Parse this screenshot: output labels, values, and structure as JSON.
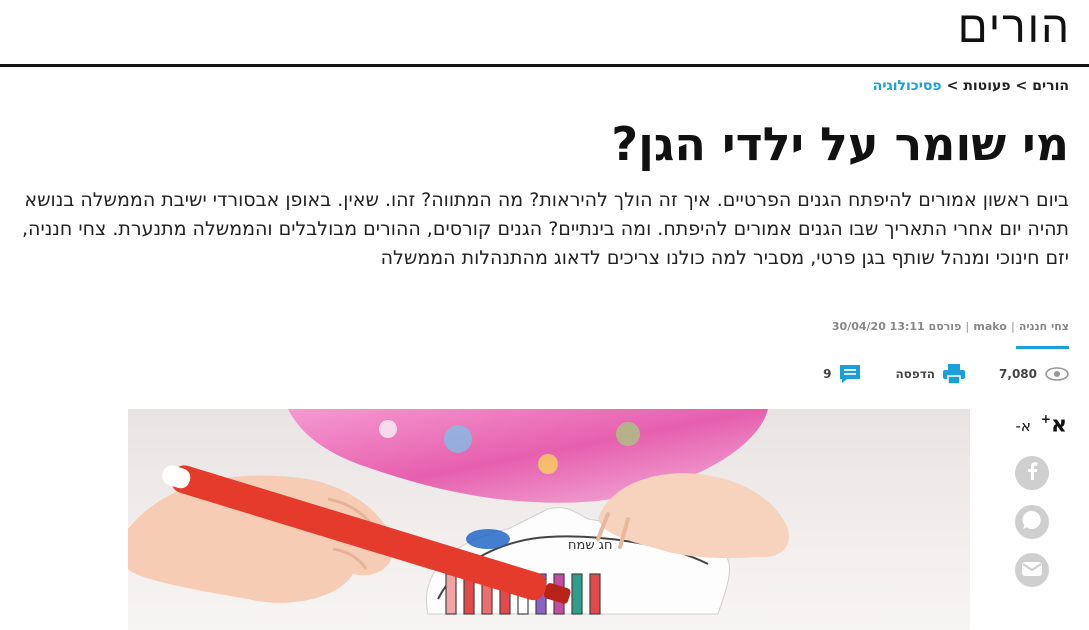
{
  "section": {
    "title": "הורים"
  },
  "breadcrumb": {
    "items": [
      "הורים",
      "פעוטות",
      "פסיכולוגיה"
    ],
    "separator": ">"
  },
  "article": {
    "headline": "מי שומר על ילדי הגן?",
    "subtitle": "ביום ראשון אמורים להיפתח הגנים הפרטיים. איך זה הולך להיראות? מה המתווה? זהו. שאין. באופן אבסורדי ישיבת הממשלה בנושא תהיה יום אחרי התאריך שבו הגנים אמורים להיפתח. ומה בינתיים? הגנים קורסים, ההורים מבולבלים והממשלה מתנערת. צחי חנניה, יזם חינוכי ומנהל שותף בגן פרטי, מסביר למה כולנו צריכים לדאוג מהתנהלות הממשלה",
    "author": "צחי חנניה",
    "source": "mako",
    "published_label": "פורסם",
    "published": "30/04/20 13:11"
  },
  "stats": {
    "views": "7,080",
    "print_label": "הדפסה",
    "comments": "9"
  },
  "font_controls": {
    "increase": "א",
    "increase_sign": "+",
    "decrease": "א",
    "decrease_sign": "-"
  },
  "share": {
    "icons": [
      "facebook-icon",
      "whatsapp-icon",
      "email-icon"
    ]
  },
  "colors": {
    "accent": "#1a9fd9",
    "text": "#111111",
    "share_bg": "#cfcfcf"
  }
}
